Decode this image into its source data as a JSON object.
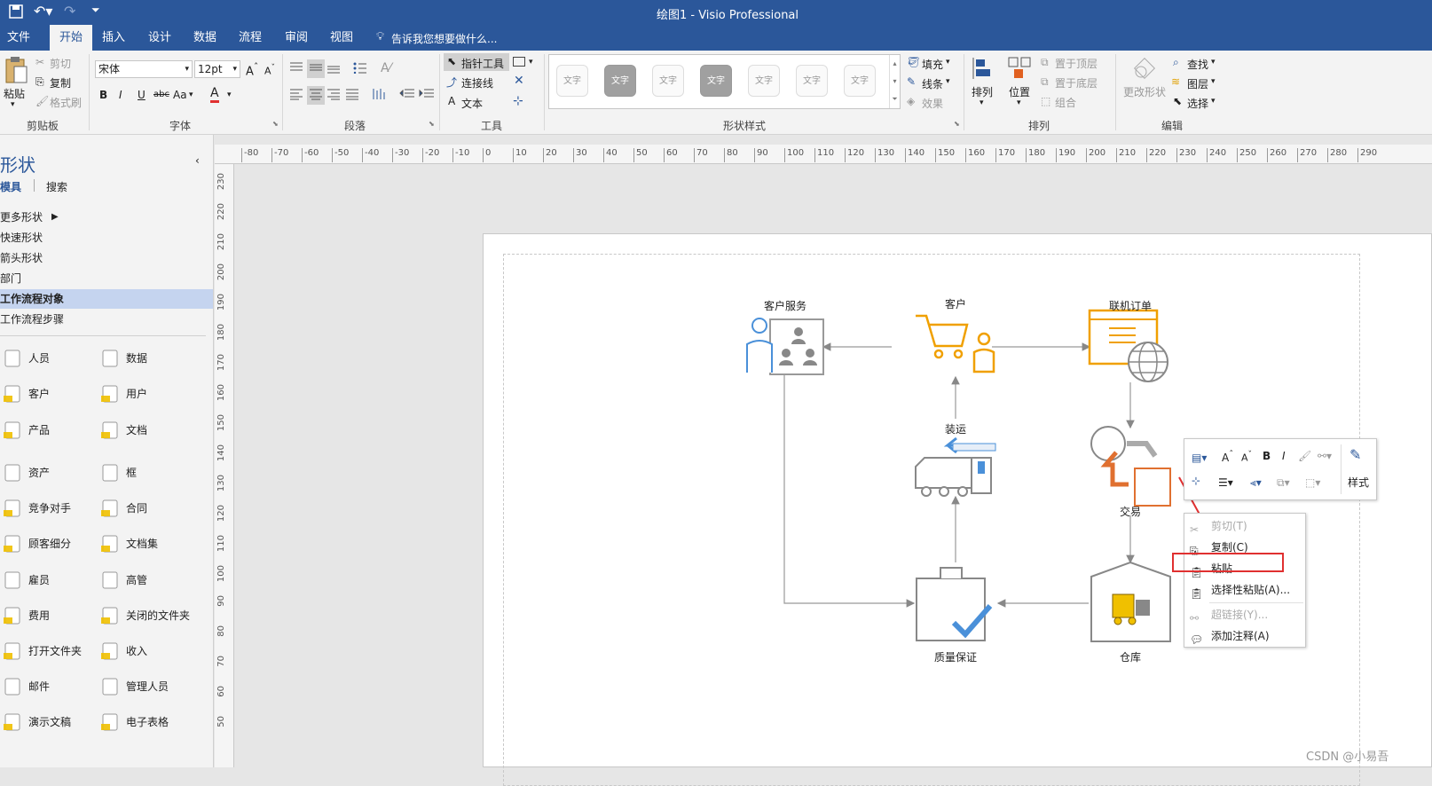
{
  "titlebar": {
    "title": "绘图1 - Visio Professional"
  },
  "menubar": {
    "tabs": [
      "文件",
      "开始",
      "插入",
      "设计",
      "数据",
      "流程",
      "审阅",
      "视图"
    ],
    "tell_me": "告诉我您想要做什么..."
  },
  "ribbon": {
    "clipboard": {
      "paste": "粘贴",
      "cut": "剪切",
      "copy": "复制",
      "format_painter": "格式刷",
      "label": "剪贴板"
    },
    "font": {
      "font_name": "宋体",
      "font_size": "12pt",
      "bold": "B",
      "italic": "I",
      "underline": "U",
      "strike": "abc",
      "case": "Aa",
      "color": "A",
      "label": "字体"
    },
    "paragraph": {
      "label": "段落"
    },
    "tools": {
      "pointer": "指针工具",
      "connector": "连接线",
      "text": "文本",
      "label": "工具"
    },
    "shape_styles": {
      "thumbs": [
        "文字",
        "文字",
        "文字",
        "文字",
        "文字",
        "文字",
        "文字"
      ],
      "fill": "填充",
      "line": "线条",
      "effect": "效果",
      "label": "形状样式"
    },
    "arrange": {
      "arrange": "排列",
      "position": "位置",
      "bring_front": "置于顶层",
      "send_back": "置于底层",
      "group": "组合",
      "label": "排列"
    },
    "editing": {
      "change_shape": "更改形状",
      "find": "查找",
      "layers": "图层",
      "select": "选择",
      "label": "编辑"
    }
  },
  "shapes_pane": {
    "title": "形状",
    "tab_stencils": "模具",
    "tab_search": "搜索",
    "nav": [
      "更多形状",
      "快速形状",
      "箭头形状",
      "部门",
      "工作流程对象",
      "工作流程步骤"
    ],
    "shapes_left": [
      "人员",
      "客户",
      "产品",
      "资产",
      "竞争对手",
      "顾客细分",
      "雇员",
      "费用",
      "打开文件夹",
      "邮件",
      "演示文稿"
    ],
    "shapes_right": [
      "数据",
      "用户",
      "文档",
      "框",
      "合同",
      "文档集",
      "高管",
      "关闭的文件夹",
      "收入",
      "管理人员",
      "电子表格"
    ]
  },
  "ruler": {
    "h_ticks": [
      "-80",
      "-70",
      "-60",
      "-50",
      "-40",
      "-30",
      "-20",
      "-10",
      "0",
      "10",
      "20",
      "30",
      "40",
      "50",
      "60",
      "70",
      "80",
      "90",
      "100",
      "110",
      "120",
      "130",
      "140",
      "150",
      "160",
      "170",
      "180",
      "190",
      "200",
      "210",
      "220",
      "230",
      "240",
      "250",
      "260",
      "270",
      "280",
      "290"
    ],
    "v_ticks": [
      "230",
      "220",
      "210",
      "200",
      "190",
      "180",
      "170",
      "160",
      "150",
      "140",
      "130",
      "120",
      "110",
      "100",
      "90",
      "80",
      "70",
      "60",
      "50"
    ]
  },
  "diagram": {
    "customer_service": "客户服务",
    "customer": "客户",
    "online_order": "联机订单",
    "shipping": "装运",
    "transaction": "交易",
    "quality": "质量保证",
    "warehouse": "仓库"
  },
  "mini_toolbar": {
    "style_label": "样式"
  },
  "context_menu": {
    "items": [
      "剪切(T)",
      "复制(C)",
      "粘贴",
      "选择性粘贴(A)...",
      "超链接(Y)...",
      "添加注释(A)"
    ]
  },
  "watermark": "CSDN @小易吾",
  "colors": {
    "accent": "#2b579a",
    "orange": "#f0a000",
    "blue": "#4a90d9",
    "red": "#e03030"
  }
}
